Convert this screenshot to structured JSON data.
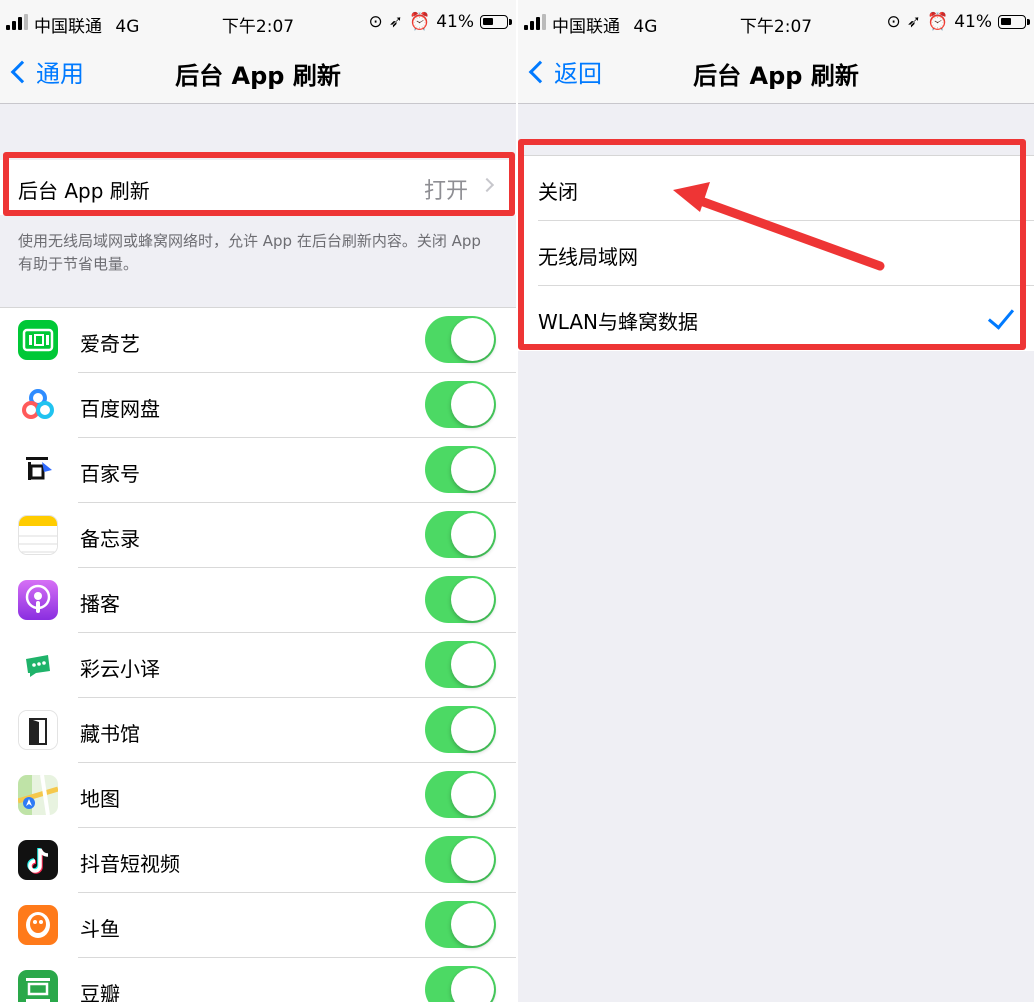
{
  "status_bar": {
    "carrier": "中国联通",
    "network": "4G",
    "time": "下午2:07",
    "battery": "41%"
  },
  "left_screen": {
    "back_label": "通用",
    "title": "后台 App 刷新",
    "main_row": {
      "label": "后台 App 刷新",
      "value": "打开"
    },
    "description": "使用无线局域网或蜂窝网络时，允许 App 在后台刷新内容。关闭 App 有助于节省电量。",
    "apps": [
      {
        "name": "爱奇艺",
        "icon": "iqiyi-icon",
        "enabled": true
      },
      {
        "name": "百度网盘",
        "icon": "baidu-netdisk-icon",
        "enabled": true
      },
      {
        "name": "百家号",
        "icon": "baijiahao-icon",
        "enabled": true
      },
      {
        "name": "备忘录",
        "icon": "notes-icon",
        "enabled": true
      },
      {
        "name": "播客",
        "icon": "podcasts-icon",
        "enabled": true
      },
      {
        "name": "彩云小译",
        "icon": "caiyun-translate-icon",
        "enabled": true
      },
      {
        "name": "藏书馆",
        "icon": "library-icon",
        "enabled": true
      },
      {
        "name": "地图",
        "icon": "maps-icon",
        "enabled": true
      },
      {
        "name": "抖音短视频",
        "icon": "douyin-icon",
        "enabled": true
      },
      {
        "name": "斗鱼",
        "icon": "douyu-icon",
        "enabled": true
      },
      {
        "name": "豆瓣",
        "icon": "douban-icon",
        "enabled": true
      }
    ]
  },
  "right_screen": {
    "back_label": "返回",
    "title": "后台 App 刷新",
    "options": [
      {
        "label": "关闭",
        "selected": false
      },
      {
        "label": "无线局域网",
        "selected": false
      },
      {
        "label": "WLAN与蜂窝数据",
        "selected": true
      }
    ]
  },
  "colors": {
    "ios_blue": "#007aff",
    "toggle_green": "#4cd964",
    "highlight_red": "#ee3535"
  }
}
